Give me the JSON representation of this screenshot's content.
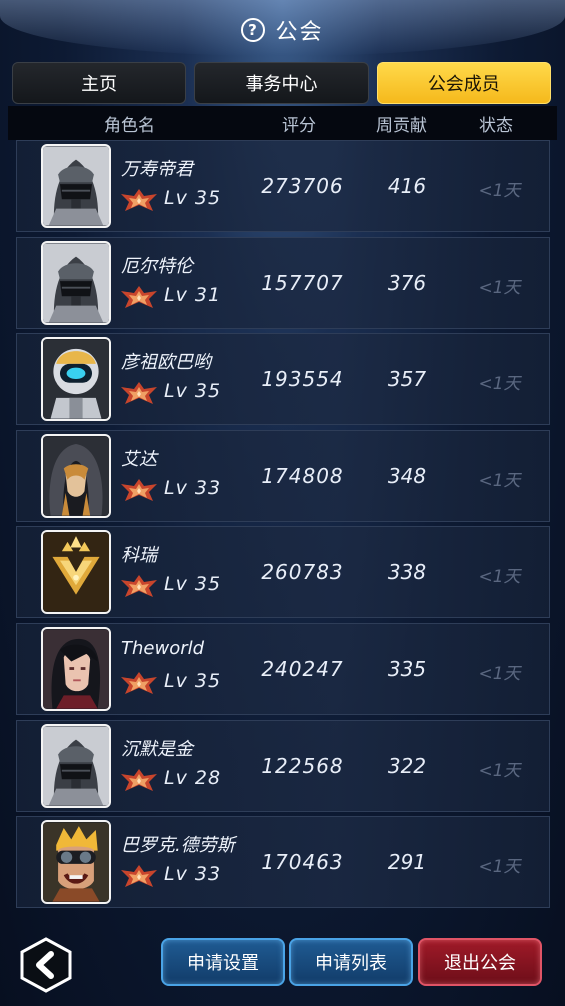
{
  "header": {
    "title": "公会",
    "help_icon": "help-circle-icon"
  },
  "tabs": [
    {
      "label": "主页",
      "active": false
    },
    {
      "label": "事务中心",
      "active": false
    },
    {
      "label": "公会成员",
      "active": true
    }
  ],
  "columns": {
    "name": "角色名",
    "score": "评分",
    "weekly": "周贡献",
    "status": "状态"
  },
  "members": [
    {
      "name": "万寿帝君",
      "level": "Lv 35",
      "score": "273706",
      "weekly": "416",
      "status": "<1天",
      "avatar": "helmet-robot-avatar"
    },
    {
      "name": "厄尔特伦",
      "level": "Lv 31",
      "score": "157707",
      "weekly": "376",
      "status": "<1天",
      "avatar": "helmet-robot-avatar"
    },
    {
      "name": "彦祖欧巴哟",
      "level": "Lv 35",
      "score": "193554",
      "weekly": "357",
      "status": "<1天",
      "avatar": "astronaut-robot-avatar"
    },
    {
      "name": "艾达",
      "level": "Lv 33",
      "score": "174808",
      "weekly": "348",
      "status": "<1天",
      "avatar": "hooded-woman-avatar"
    },
    {
      "name": "科瑞",
      "level": "Lv 35",
      "score": "260783",
      "weekly": "338",
      "status": "<1天",
      "avatar": "gold-emblem-avatar"
    },
    {
      "name": "Theworld",
      "level": "Lv 35",
      "score": "240247",
      "weekly": "335",
      "status": "<1天",
      "avatar": "dark-hair-woman-avatar"
    },
    {
      "name": "沉默是金",
      "level": "Lv 28",
      "score": "122568",
      "weekly": "322",
      "status": "<1天",
      "avatar": "helmet-robot-avatar"
    },
    {
      "name": "巴罗克.德劳斯",
      "level": "Lv 33",
      "score": "170463",
      "weekly": "291",
      "status": "<1天",
      "avatar": "goggles-man-avatar"
    }
  ],
  "footer": {
    "back_icon": "chevron-left-icon",
    "apply_settings": "申请设置",
    "apply_list": "申请列表",
    "leave_guild": "退出公会"
  },
  "colors": {
    "active_tab": "#f5b91c",
    "leave_button": "#a01a28",
    "action_button": "#1f5b93"
  }
}
